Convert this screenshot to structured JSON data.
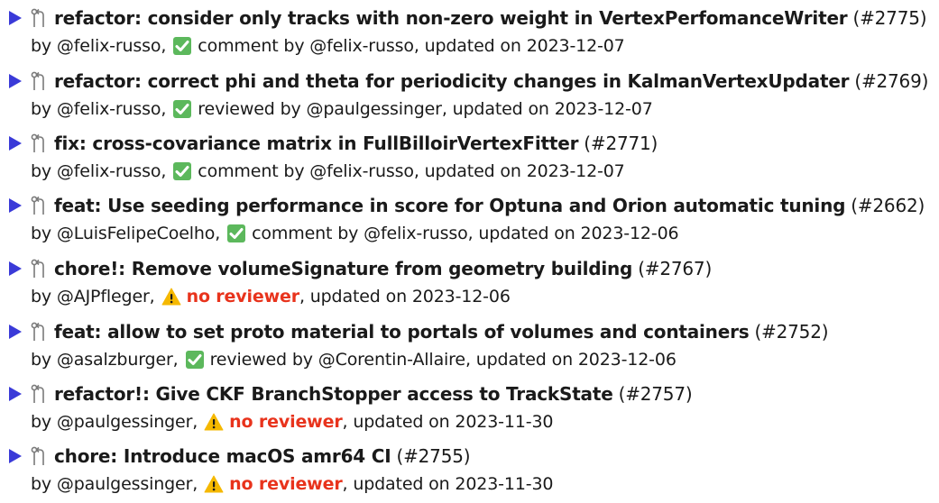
{
  "items": [
    {
      "title": "refactor: consider only tracks with non-zero weight in VertexPerfomanceWriter",
      "number": "(#2775)",
      "author": "by @felix-russo,",
      "status": "check",
      "review": "comment by @felix-russo",
      "updated": ", updated on 2023-12-07"
    },
    {
      "title": "refactor: correct phi and theta for periodicity changes in KalmanVertexUpdater",
      "number": "(#2769)",
      "author": "by @felix-russo,",
      "status": "check",
      "review": "reviewed by @paulgessinger",
      "updated": ", updated on 2023-12-07"
    },
    {
      "title": "fix: cross-covariance matrix in FullBilloirVertexFitter",
      "number": "(#2771)",
      "author": "by @felix-russo,",
      "status": "check",
      "review": "comment by @felix-russo",
      "updated": ", updated on 2023-12-07"
    },
    {
      "title": "feat: Use seeding performance in score for Optuna and Orion automatic tuning",
      "number": "(#2662)",
      "author": "by @LuisFelipeCoelho,",
      "status": "check",
      "review": "comment by @felix-russo",
      "updated": ", updated on 2023-12-06"
    },
    {
      "title": "chore!: Remove volumeSignature from geometry building",
      "number": "(#2767)",
      "author": "by @AJPfleger,",
      "status": "warning",
      "review": "no reviewer",
      "updated": ", updated on 2023-12-06"
    },
    {
      "title": "feat: allow to set proto material to portals of volumes and containers",
      "number": "(#2752)",
      "author": "by @asalzburger,",
      "status": "check",
      "review": "reviewed by @Corentin-Allaire",
      "updated": ", updated on 2023-12-06"
    },
    {
      "title": "refactor!: Give CKF BranchStopper access to TrackState",
      "number": "(#2757)",
      "author": "by @paulgessinger,",
      "status": "warning",
      "review": "no reviewer",
      "updated": ", updated on 2023-11-30"
    },
    {
      "title": "chore: Introduce macOS amr64 CI",
      "number": "(#2755)",
      "author": "by @paulgessinger,",
      "status": "warning",
      "review": "no reviewer",
      "updated": ", updated on 2023-11-30"
    }
  ],
  "colors": {
    "arrow": "#3a3ad8",
    "check_bg": "#5cb85c",
    "warning_bg": "#f5b800",
    "no_reviewer": "#e8331c",
    "pr_icon": "#7a7a7a"
  },
  "icons": {
    "expand": "triangle-right-icon",
    "pr": "git-pull-request-icon",
    "check": "check-mark-button-icon",
    "warning": "warning-icon"
  }
}
